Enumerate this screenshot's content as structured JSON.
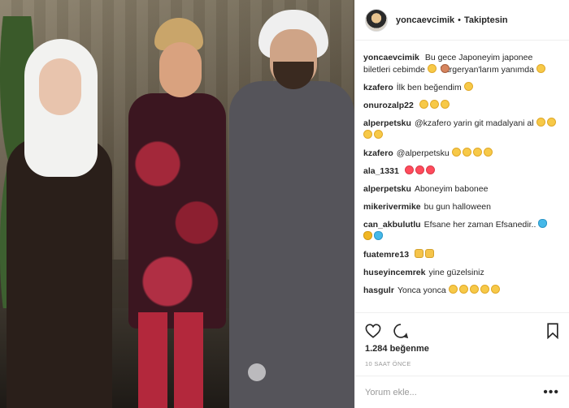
{
  "header": {
    "username": "yoncaevcimik",
    "separator": "•",
    "follow_label": "Takiptesin"
  },
  "caption": {
    "username": "yoncaevcimik",
    "text1": "Bu gece Japoneyim japonee biletleri cebimde",
    "text2": "Targeryan'larım yanımda",
    "emoji1": [
      "face-tongue"
    ],
    "emoji2": [
      "person-raising-hand"
    ],
    "emoji3": [
      "face-sweat-smile"
    ]
  },
  "comments": [
    {
      "username": "kzafero",
      "text": "İlk ben beğendim",
      "emojis": [
        "face-grin"
      ]
    },
    {
      "username": "onurozalp22",
      "text": "",
      "emojis": [
        "face-grin",
        "face-grin",
        "face-grin"
      ]
    },
    {
      "username": "alperpetsku",
      "text": "@kzafero yarin git madalyani al",
      "emojis": [
        "face-grin",
        "face-grin",
        "face-grin",
        "face-grin"
      ]
    },
    {
      "username": "kzafero",
      "text": "@alperpetsku",
      "emojis": [
        "face-grin",
        "face-grin",
        "face-grin",
        "face-grin"
      ]
    },
    {
      "username": "ala_1331",
      "text": "",
      "emojis": [
        "face-heart-eyes",
        "face-heart-eyes",
        "face-heart-eyes"
      ]
    },
    {
      "username": "alperpetsku",
      "text": "Aboneyim babonee",
      "emojis": []
    },
    {
      "username": "mikerivermike",
      "text": "bu gun halloween",
      "emojis": []
    },
    {
      "username": "can_akbulutlu",
      "text": "Efsane her zaman Efsanedir..",
      "emojis": [
        "heart-blue",
        "heart-gold",
        "heart-blue"
      ]
    },
    {
      "username": "fuatemre13",
      "text": "",
      "emojis": [
        "hand-thumbs-up",
        "hand-thumbs-up"
      ]
    },
    {
      "username": "huseyincemrek",
      "text": "yine güzelsiniz",
      "emojis": []
    },
    {
      "username": "hasgulr",
      "text": "Yonca yonca",
      "emojis": [
        "face-kiss",
        "face-kiss",
        "face-kiss",
        "face-kiss",
        "face-kiss"
      ]
    }
  ],
  "actions": {
    "likes": "1.284 beğenme",
    "time": "10 SAAT ÖNCE"
  },
  "add_comment": {
    "placeholder": "Yorum ekle...",
    "more": "•••"
  },
  "icons": [
    "heart-icon",
    "comment-icon",
    "bookmark-icon"
  ]
}
